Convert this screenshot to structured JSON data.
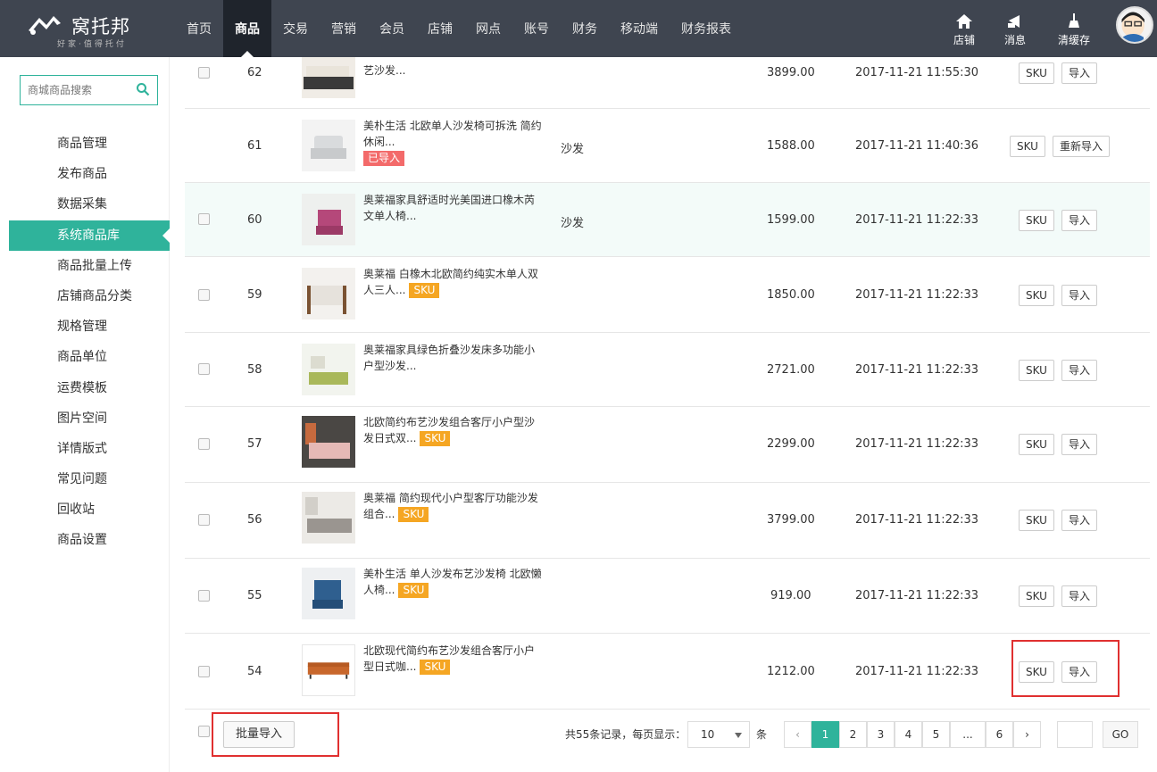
{
  "header": {
    "logo_text": "窝托邦",
    "logo_sub": "好家·值得托付",
    "nav": [
      "首页",
      "商品",
      "交易",
      "营销",
      "会员",
      "店铺",
      "网点",
      "账号",
      "财务",
      "移动端",
      "财务报表"
    ],
    "active_nav": "商品",
    "tools": [
      {
        "label": "店铺",
        "icon": "home-icon"
      },
      {
        "label": "消息",
        "icon": "bell-icon"
      },
      {
        "label": "清缓存",
        "icon": "broom-icon"
      }
    ]
  },
  "sidebar": {
    "search_placeholder": "商城商品搜索",
    "items": [
      "商品管理",
      "发布商品",
      "数据采集",
      "系统商品库",
      "商品批量上传",
      "店铺商品分类",
      "规格管理",
      "商品单位",
      "运费模板",
      "图片空间",
      "详情版式",
      "常见问题",
      "回收站",
      "商品设置"
    ],
    "active": "系统商品库"
  },
  "rows": [
    {
      "id": "62",
      "title_line1": "艺沙发...",
      "title_line2": "",
      "badge": "",
      "category": "",
      "price": "3899.00",
      "time": "2017-11-21 11:55:30",
      "btn_sku": "SKU",
      "btn_action": "导入",
      "checkbox": true
    },
    {
      "id": "61",
      "title_line1": "美朴生活 北欧单人沙发椅可拆洗 简约",
      "title_line2": "休闲...",
      "badge": "已导入",
      "category": "沙发",
      "price": "1588.00",
      "time": "2017-11-21 11:40:36",
      "btn_sku": "SKU",
      "btn_action": "重新导入",
      "checkbox": false
    },
    {
      "id": "60",
      "title_line1": "奥莱福家具舒适时光美国进口橡木芮",
      "title_line2": "文单人椅...",
      "badge": "",
      "category": "沙发",
      "price": "1599.00",
      "time": "2017-11-21 11:22:33",
      "btn_sku": "SKU",
      "btn_action": "导入",
      "checkbox": true
    },
    {
      "id": "59",
      "title_line1": "奥莱福 白橡木北欧简约纯实木单人双",
      "title_line2": "人三人...",
      "badge": "SKU",
      "category": "",
      "price": "1850.00",
      "time": "2017-11-21 11:22:33",
      "btn_sku": "SKU",
      "btn_action": "导入",
      "checkbox": true
    },
    {
      "id": "58",
      "title_line1": "奥莱福家具绿色折叠沙发床多功能小",
      "title_line2": "户型沙发...",
      "badge": "",
      "category": "",
      "price": "2721.00",
      "time": "2017-11-21 11:22:33",
      "btn_sku": "SKU",
      "btn_action": "导入",
      "checkbox": true
    },
    {
      "id": "57",
      "title_line1": "北欧简约布艺沙发组合客厅小户型沙",
      "title_line2": "发日式双...",
      "badge": "SKU",
      "category": "",
      "price": "2299.00",
      "time": "2017-11-21 11:22:33",
      "btn_sku": "SKU",
      "btn_action": "导入",
      "checkbox": true
    },
    {
      "id": "56",
      "title_line1": "奥莱福 简约现代小户型客厅功能沙发",
      "title_line2": "组合...",
      "badge": "SKU",
      "category": "",
      "price": "3799.00",
      "time": "2017-11-21 11:22:33",
      "btn_sku": "SKU",
      "btn_action": "导入",
      "checkbox": true
    },
    {
      "id": "55",
      "title_line1": "美朴生活 单人沙发布艺沙发椅 北欧懒",
      "title_line2": "人椅...",
      "badge": "SKU",
      "category": "",
      "price": "919.00",
      "time": "2017-11-21 11:22:33",
      "btn_sku": "SKU",
      "btn_action": "导入",
      "checkbox": true
    },
    {
      "id": "54",
      "title_line1": "北欧现代简约布艺沙发组合客厅小户",
      "title_line2": "型日式咖...",
      "badge": "SKU",
      "category": "",
      "price": "1212.00",
      "time": "2017-11-21 11:22:33",
      "btn_sku": "SKU",
      "btn_action": "导入",
      "checkbox": true
    }
  ],
  "footer": {
    "batch_import": "批量导入",
    "summary": "共55条记录，每页显示：",
    "page_size": "10",
    "unit": "条",
    "pages": [
      "‹",
      "1",
      "2",
      "3",
      "4",
      "5",
      "...",
      "6",
      "›"
    ],
    "current_page": "1",
    "go": "GO"
  },
  "colors": {
    "accent": "#2fb39b",
    "topbar": "#3f4550",
    "badge_sku": "#f5a623",
    "badge_imported": "#f36a6a",
    "highlight_box": "#e03030"
  }
}
